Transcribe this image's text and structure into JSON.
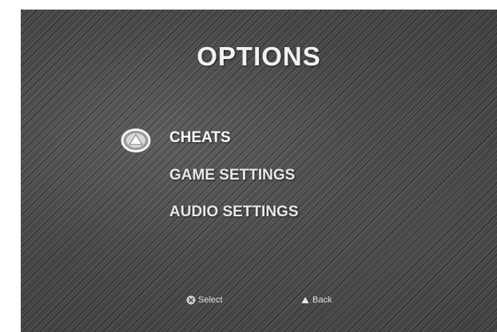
{
  "screen": {
    "title": "OPTIONS"
  },
  "menu": {
    "items": [
      {
        "label": "CHEATS",
        "selected": true
      },
      {
        "label": "GAME SETTINGS",
        "selected": false
      },
      {
        "label": "AUDIO SETTINGS",
        "selected": false
      }
    ],
    "cursor_icon": "triangle-button-cursor-icon"
  },
  "hints": {
    "select": {
      "icon": "cross-button-icon",
      "label": "Select"
    },
    "back": {
      "icon": "triangle-button-icon",
      "label": "Back"
    }
  },
  "colors": {
    "text": "#f2f2f2",
    "background": "#4a4a4a"
  }
}
